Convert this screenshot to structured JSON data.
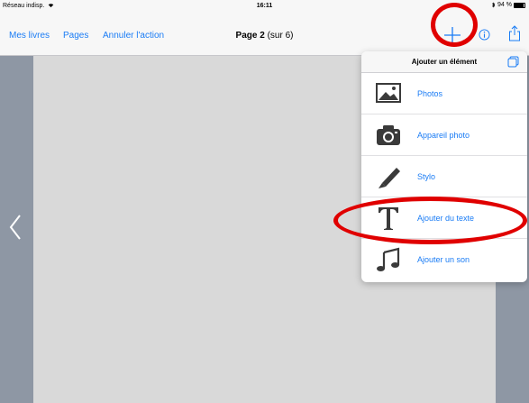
{
  "status_bar": {
    "carrier": "Réseau indisp.",
    "time": "16:11",
    "battery": "94 %",
    "battery_level": 0.94
  },
  "navbar": {
    "my_books": "Mes livres",
    "pages": "Pages",
    "undo": "Annuler l'action",
    "page_label": "Page 2",
    "page_total": "(sur 6)"
  },
  "popover": {
    "title": "Ajouter un élément",
    "items": [
      {
        "label": "Photos",
        "icon": "photos-icon"
      },
      {
        "label": "Appareil photo",
        "icon": "camera-icon"
      },
      {
        "label": "Stylo",
        "icon": "pen-icon"
      },
      {
        "label": "Ajouter du texte",
        "icon": "text-icon"
      },
      {
        "label": "Ajouter un son",
        "icon": "music-note-icon"
      }
    ]
  },
  "colors": {
    "accent": "#1a7cf5",
    "annotation": "#e00000",
    "background": "#8e97a4",
    "page": "#d9d9d9"
  }
}
